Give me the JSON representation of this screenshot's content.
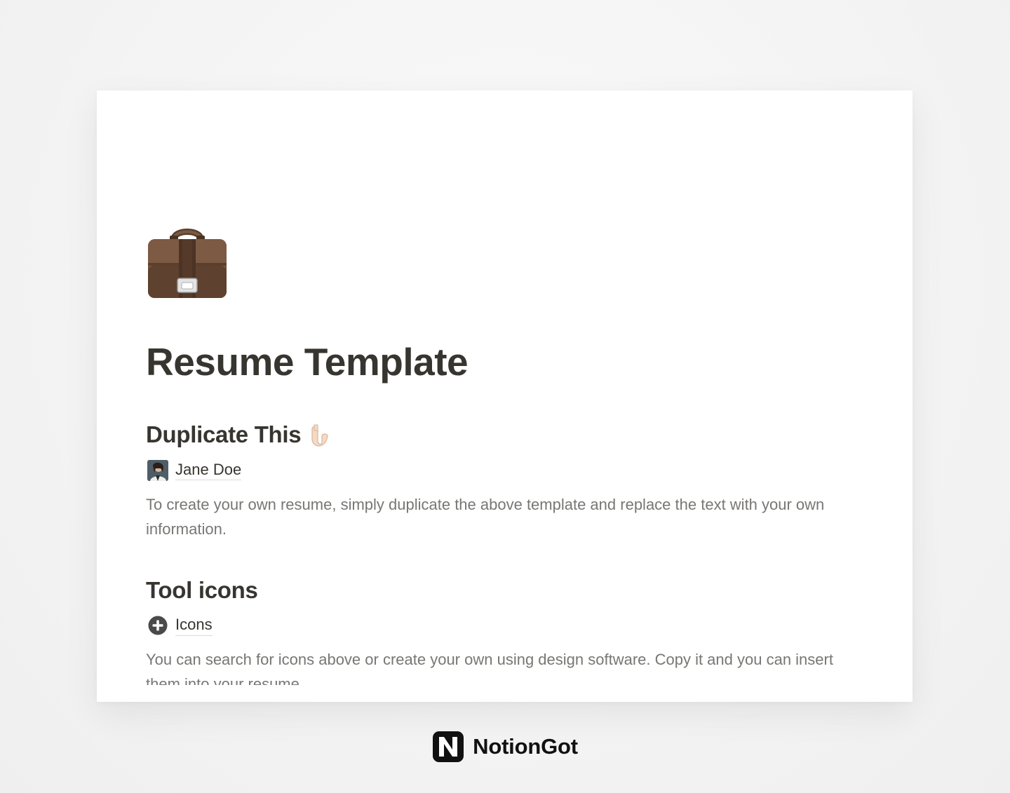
{
  "page": {
    "title": "Resume Template",
    "icon": "briefcase-icon"
  },
  "sections": {
    "duplicate": {
      "heading": "Duplicate This",
      "heading_icon": "pointing-down-hand-icon",
      "link_label": "Jane Doe",
      "link_icon": "profile-photo-icon",
      "text": "To create your own resume, simply duplicate the above template and replace the text with your own information."
    },
    "tools": {
      "heading": "Tool icons",
      "link_label": "Icons",
      "link_icon": "plus-circle-icon",
      "text": "You can search for icons above or create your own using design software. Copy it and you can insert them into your resume."
    }
  },
  "footer": {
    "brand_name": "NotionGot",
    "logo": "notion-logo-icon"
  },
  "colors": {
    "text_primary": "#37352f",
    "text_secondary": "#787774",
    "background": "#f4f4f4",
    "card": "#ffffff"
  }
}
